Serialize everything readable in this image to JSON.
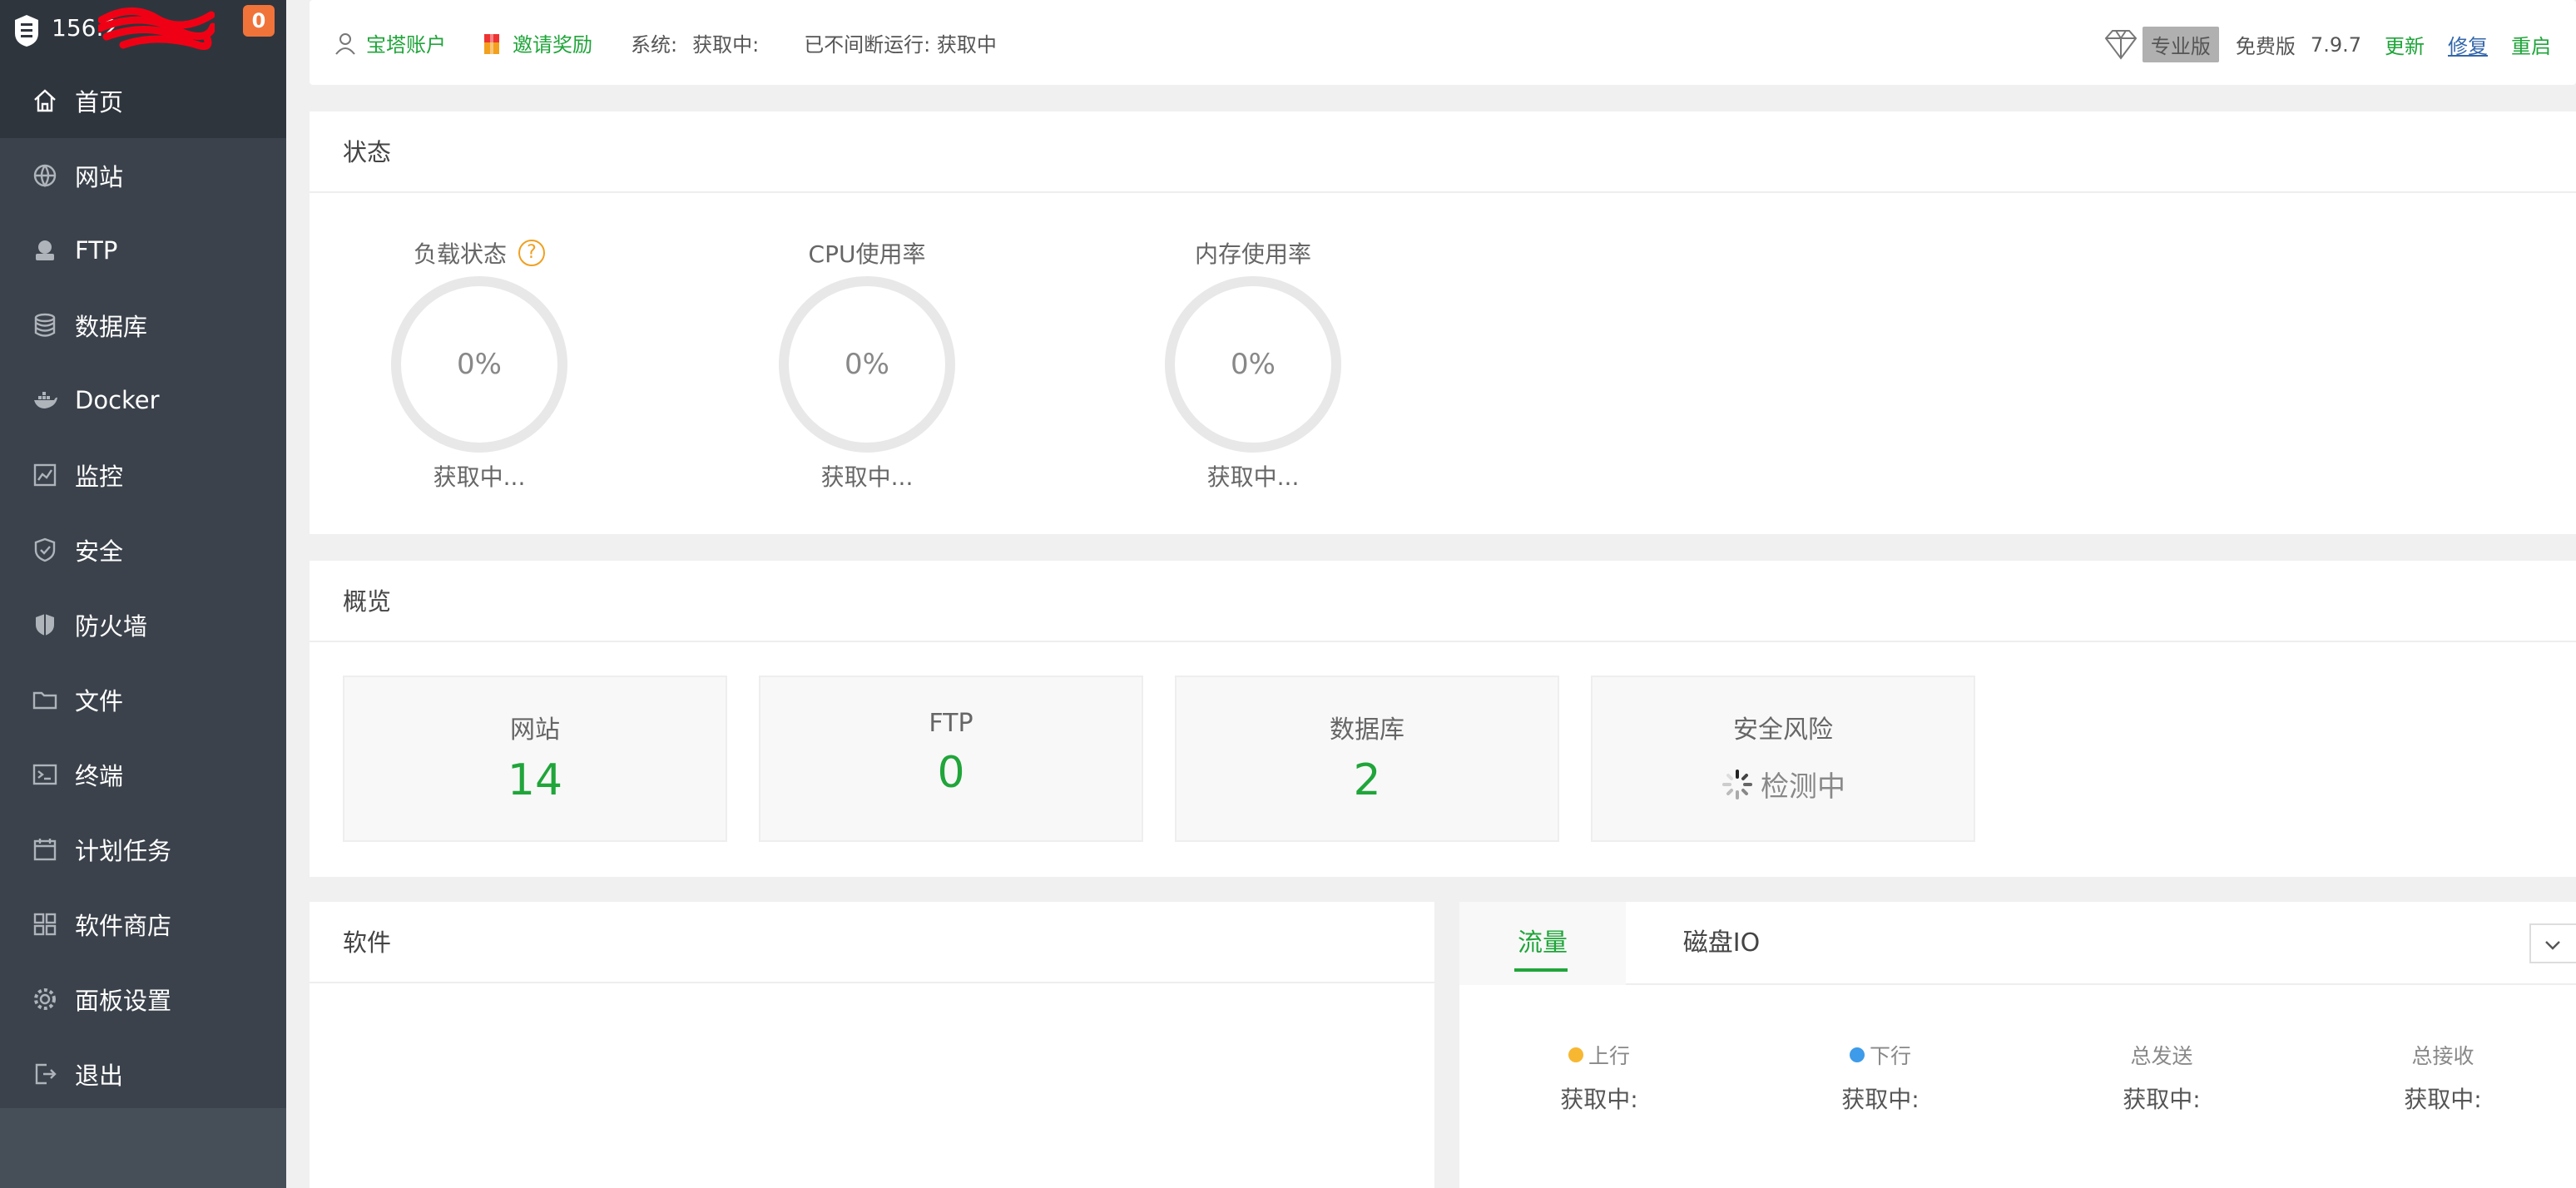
{
  "sidebar": {
    "ip_prefix": "156.2",
    "badge": "0",
    "items": [
      {
        "label": "首页",
        "icon": "home-icon"
      },
      {
        "label": "网站",
        "icon": "globe-icon"
      },
      {
        "label": "FTP",
        "icon": "ftp-icon"
      },
      {
        "label": "数据库",
        "icon": "database-icon"
      },
      {
        "label": "Docker",
        "icon": "docker-icon"
      },
      {
        "label": "监控",
        "icon": "monitor-icon"
      },
      {
        "label": "安全",
        "icon": "shield-check-icon"
      },
      {
        "label": "防火墙",
        "icon": "firewall-icon"
      },
      {
        "label": "文件",
        "icon": "folder-icon"
      },
      {
        "label": "终端",
        "icon": "terminal-icon"
      },
      {
        "label": "计划任务",
        "icon": "calendar-icon"
      },
      {
        "label": "软件商店",
        "icon": "apps-grid-icon"
      },
      {
        "label": "面板设置",
        "icon": "gear-icon"
      },
      {
        "label": "退出",
        "icon": "logout-icon"
      }
    ]
  },
  "header": {
    "account": "宝塔账户",
    "invite": "邀请奖励",
    "system_label": "系统:",
    "system_value": "获取中:",
    "uptime": "已不间断运行: 获取中",
    "pro": "专业版",
    "free": "免费版",
    "version": "7.9.7",
    "update": "更新",
    "repair": "修复",
    "restart": "重启"
  },
  "status": {
    "title": "状态",
    "gauges": [
      {
        "title": "负载状态",
        "value": "0%",
        "status": "获取中..."
      },
      {
        "title": "CPU使用率",
        "value": "0%",
        "status": "获取中..."
      },
      {
        "title": "内存使用率",
        "value": "0%",
        "status": "获取中..."
      }
    ]
  },
  "overview": {
    "title": "概览",
    "cards": [
      {
        "label": "网站",
        "value": "14"
      },
      {
        "label": "FTP",
        "value": "0"
      },
      {
        "label": "数据库",
        "value": "2"
      },
      {
        "label": "安全风险",
        "value": "检测中"
      }
    ]
  },
  "software": {
    "title": "软件"
  },
  "traffic": {
    "tabs": [
      "流量",
      "磁盘IO"
    ],
    "stats": [
      {
        "label": "上行",
        "value": "获取中:",
        "dot": "#f7b731"
      },
      {
        "label": "下行",
        "value": "获取中:",
        "dot": "#3d9be9"
      },
      {
        "label": "总发送",
        "value": "获取中:"
      },
      {
        "label": "总接收",
        "value": "获取中:"
      }
    ]
  },
  "colors": {
    "accent": "#20a53a",
    "sidebar": "#3b424b",
    "badge": "#f0733a"
  }
}
